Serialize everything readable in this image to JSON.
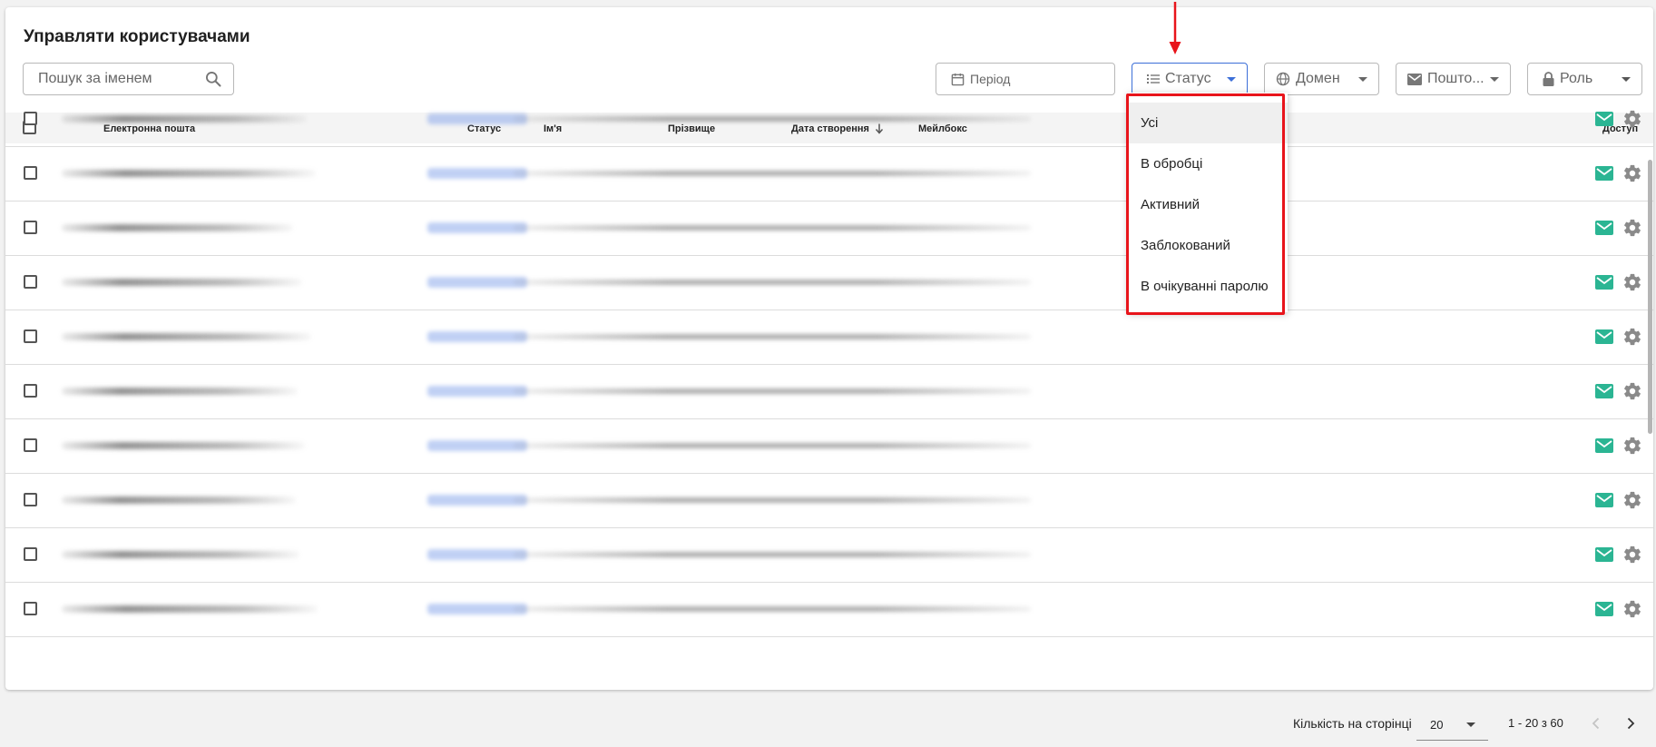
{
  "header": {
    "title": "Управляти користувачами"
  },
  "search": {
    "placeholder": "Пошук за іменем"
  },
  "filters": {
    "period": "Період",
    "status": "Статус",
    "domain": "Домен",
    "mailbox": "Пошто...",
    "role": "Роль"
  },
  "table": {
    "columns": {
      "email": "Електронна пошта",
      "status": "Статус",
      "first_name": "Ім'я",
      "last_name": "Прізвище",
      "created": "Дата створення",
      "mailbox": "Мейлбокс",
      "access": "Доступ"
    }
  },
  "status_dropdown": {
    "options": [
      "Усі",
      "В обробці",
      "Активний",
      "Заблокований",
      "В очікуванні паролю"
    ],
    "selected_index": 0
  },
  "pagination": {
    "per_page_label": "Кількість на сторінці",
    "per_page_value": "20",
    "range": "1 - 20 з 60"
  },
  "colors": {
    "accent": "#3c6fd8",
    "mail_icon": "#2bb593",
    "highlight_border": "#e8141b"
  },
  "icons": [
    "search-icon",
    "calendar-icon",
    "list-icon",
    "globe-icon",
    "envelope-icon",
    "lock-icon",
    "sort-arrow-down-icon",
    "mail-icon",
    "gear-icon",
    "chevron-left-icon",
    "chevron-right-icon"
  ]
}
